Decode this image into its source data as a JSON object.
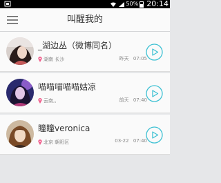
{
  "status_bar": {
    "battery": "50%",
    "time": "20:14",
    "icons": [
      "notification-icon",
      "wifi-icon",
      "signal-icon",
      "battery-icon"
    ]
  },
  "header": {
    "title": "叫醒我的",
    "menu_icon": "menu-icon"
  },
  "items": [
    {
      "name": "_湖边丛（微博同名）",
      "location": "湖南 长沙",
      "day": "昨天",
      "time": "07:05"
    },
    {
      "name": "喵喵喵喵喵姑凉",
      "location": "云南,,",
      "day": "前天",
      "time": "07:40"
    },
    {
      "name": "瞳瞳veronica",
      "location": "北京 朝阳区",
      "day": "03-22",
      "time": "07:40"
    }
  ],
  "colors": {
    "accent": "#3ec1d3",
    "location_pin": "#f05b8a",
    "background": "#e6e7e9",
    "row": "#fafafa"
  }
}
